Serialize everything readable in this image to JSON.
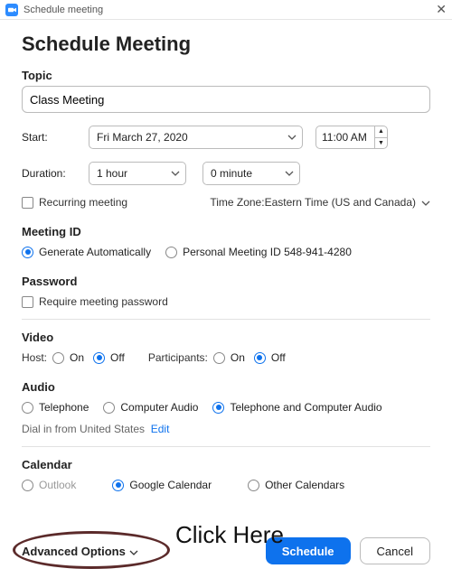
{
  "window": {
    "title": "Schedule meeting"
  },
  "heading": "Schedule Meeting",
  "topic": {
    "label": "Topic",
    "value": "Class Meeting"
  },
  "start": {
    "label": "Start:",
    "date": "Fri  March 27, 2020",
    "time": "11:00 AM"
  },
  "duration": {
    "label": "Duration:",
    "hours": "1 hour",
    "minutes": "0 minute"
  },
  "recurring": {
    "label": "Recurring meeting",
    "checked": false
  },
  "timezone": {
    "prefix": "Time Zone: ",
    "value": "Eastern Time (US and Canada)"
  },
  "meetingId": {
    "label": "Meeting ID",
    "generate": "Generate Automatically",
    "personal": "Personal Meeting ID 548-941-4280"
  },
  "password": {
    "label": "Password",
    "require": "Require meeting password",
    "checked": false
  },
  "video": {
    "label": "Video",
    "hostLabel": "Host:",
    "participantsLabel": "Participants:",
    "on": "On",
    "off": "Off"
  },
  "audio": {
    "label": "Audio",
    "telephone": "Telephone",
    "computer": "Computer Audio",
    "both": "Telephone and Computer Audio",
    "dialin": "Dial in from United States",
    "edit": "Edit"
  },
  "calendar": {
    "label": "Calendar",
    "outlook": "Outlook",
    "google": "Google Calendar",
    "other": "Other Calendars"
  },
  "advanced": "Advanced Options",
  "buttons": {
    "schedule": "Schedule",
    "cancel": "Cancel"
  },
  "annotation": "Click Here"
}
